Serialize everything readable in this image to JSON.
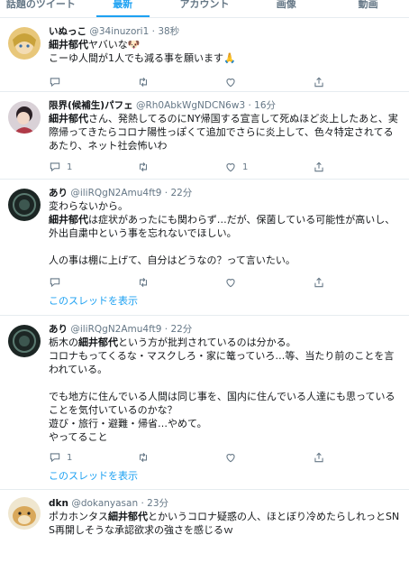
{
  "tabs": [
    {
      "label": "話題のツイート"
    },
    {
      "label": "最新"
    },
    {
      "label": "アカウント"
    },
    {
      "label": "画像"
    },
    {
      "label": "動画"
    }
  ],
  "tweets": [
    {
      "name": "いぬっこ",
      "handle": "@34inuzori1",
      "time": "· 38秒",
      "line1_hl": "細井郁代",
      "line1_rest": "ヤバいな🐶",
      "line2": "こーゆ人間が1人でも減る事を願います🙏",
      "reply": "",
      "retweet": "",
      "like": ""
    },
    {
      "name": "限界(候補生)パフェ",
      "handle": "@Rh0AbkWgNDCN6w3",
      "time": "· 16分",
      "text_hl": "細井郁代",
      "text_rest": "さん、発熱してるのにNY帰国する宣言して死ぬほど炎上したあと、実際帰ってきたらコロナ陽性っぽくて追加でさらに炎上して、色々特定されてるあたり、ネット社会怖いわ",
      "reply": "1",
      "retweet": "",
      "like": "1"
    },
    {
      "name": "あり",
      "handle": "@iliRQgN2Amu4ft9",
      "time": "· 22分",
      "line1": "変わらないから。",
      "line2_hl": "細井郁代",
      "line2_rest": "は症状があったにも関わらず…だが、保菌している可能性が高いし、外出自粛中という事を忘れないでほしい。",
      "line3": "人の事は棚に上げて、自分はどうなの？って言いたい。",
      "reply": "",
      "retweet": "",
      "like": "",
      "thread": "このスレッドを表示"
    },
    {
      "name": "あり",
      "handle": "@iliRQgN2Amu4ft9",
      "time": "· 22分",
      "line1_pre": "栃木の",
      "line1_hl": "細井郁代",
      "line1_rest": "という方が批判されているのは分かる。",
      "line2": "コロナもってくるな・マスクしろ・家に篭っていろ…等、当たり前のことを言われている。",
      "line3": "でも地方に住んでいる人間は同じ事を、国内に住んでいる人達にも思っていることを気付いているのかな？",
      "line4": "遊び・旅行・避難・帰省…やめて。",
      "line5": "やってること",
      "reply": "1",
      "retweet": "",
      "like": "",
      "thread": "このスレッドを表示"
    },
    {
      "name": "dkn",
      "handle": "@dokanyasan",
      "time": "· 23分",
      "line1_pre": "ポカホンタス",
      "line1_hl": "細井郁代",
      "line1_rest": "とかいうコロナ疑惑の人、ほとぼり冷めたらしれっとSNS再開しそうな承認欲求の強さを感じるｗ"
    }
  ],
  "colors": {
    "accent": "#1da1f2",
    "muted": "#657786",
    "border": "#e6ecf0"
  },
  "icons": [
    "reply-icon",
    "retweet-icon",
    "like-icon",
    "share-icon"
  ]
}
